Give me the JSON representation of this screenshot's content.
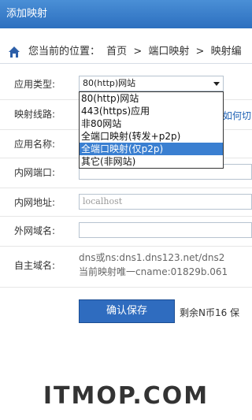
{
  "window": {
    "title": "添加映射"
  },
  "breadcrumb": {
    "prefix": "您当前的位置：",
    "items": [
      "首页",
      ">",
      "端口映射",
      ">",
      "映射编"
    ]
  },
  "form": {
    "app_type": {
      "label": "应用类型:",
      "value": "80(http)网站"
    },
    "route": {
      "label": "映射线路:",
      "help_link": "如何切"
    },
    "app_name": {
      "label": "应用名称:"
    },
    "lan_port": {
      "label": "内网端口:"
    },
    "lan_addr": {
      "label": "内网地址:",
      "placeholder": "localhost"
    },
    "wan_domain": {
      "label": "外网域名:"
    },
    "own_domain": {
      "label": "自主域名:",
      "line1": "dns或ns:dns1.dns123.net/dns2",
      "line2": "当前映射唯一cname:01829b.061"
    }
  },
  "dropdown": {
    "options": [
      "80(http)网站",
      "443(https)应用",
      "非80网站",
      "全端口映射(转发+p2p)",
      "全端口映射(仅p2p)",
      "其它(非网站)"
    ],
    "selected_index": 4
  },
  "actions": {
    "save_label": "确认保存",
    "remaining": "剩余N币16 保"
  },
  "watermark": "ITMOP.COM"
}
